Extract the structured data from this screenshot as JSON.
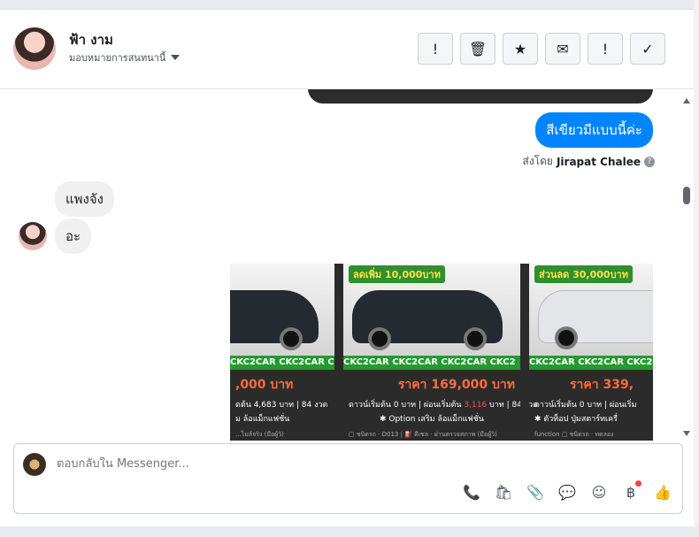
{
  "header": {
    "name": "ฟ้า งาม",
    "subtitle": "มอบหมายการสนทนานี้",
    "actions": [
      {
        "label": "!",
        "icon": "alert-icon"
      },
      {
        "label": "🗑",
        "icon": "trash-icon"
      },
      {
        "label": "★",
        "icon": "star-icon"
      },
      {
        "label": "✉",
        "icon": "mail-icon"
      },
      {
        "label": "!",
        "icon": "important-icon"
      },
      {
        "label": "✓",
        "icon": "check-icon"
      }
    ]
  },
  "messages": {
    "outgoing": "สีเขียวมีแบบนี้ค่ะ",
    "sent_by_prefix": "ส่งโดย",
    "sent_by_name": "Jirapat Chalee",
    "incoming_1": "แพงจัง",
    "incoming_2": "อะ"
  },
  "carousel": [
    {
      "promo": "",
      "banner": "CKC2CAR CKC2CAR CKC2CAR",
      "price": ",000 บาท",
      "terms": "ดต้น 4,683 บาท | 84 งวด",
      "option": "ม ล้อแม็กแฟชั่น",
      "foot": "...ไมล์จริง (มือผู้วิ)"
    },
    {
      "promo": "ลดเพิ่ม 10,000บาท",
      "banner": "CKC2CAR CKC2CAR CKC2CAR CKC2",
      "price": "ราคา 169,000 บาท",
      "terms_a": "ดาวน์เริ่มต้น 0 บาท | ผ่อนเริ่มต้น ",
      "terms_red": "3,116",
      "terms_b": " บาท | 84 งวด",
      "option": "✱ Option เสริม ล้อแม็กแฟชั่น",
      "foot": "▢ ชนิดรถ · D013 | ⛽ ดีเซล · ผ่านตรวจสภาพ (มือผู้วิ)"
    },
    {
      "promo": "ส่วนลด 30,000บาท",
      "banner": "CKC2CAR CKC2CAR CKC2CAR",
      "price": "ราคา 339,",
      "terms": "ดาวน์เริ่มต้น 0 บาท | ผ่อนเริ่ม",
      "option": "✱ ตัวท็อป ปุ่มสตาร์ทเครื่",
      "foot": "function ▢ ชนิดรถ · ทดลอง"
    }
  ],
  "composer": {
    "placeholder": "ตอบกลับใน Messenger...",
    "tools": [
      "📞",
      "🛍",
      "📎",
      "💬",
      "☺",
      "฿",
      "👍"
    ]
  }
}
